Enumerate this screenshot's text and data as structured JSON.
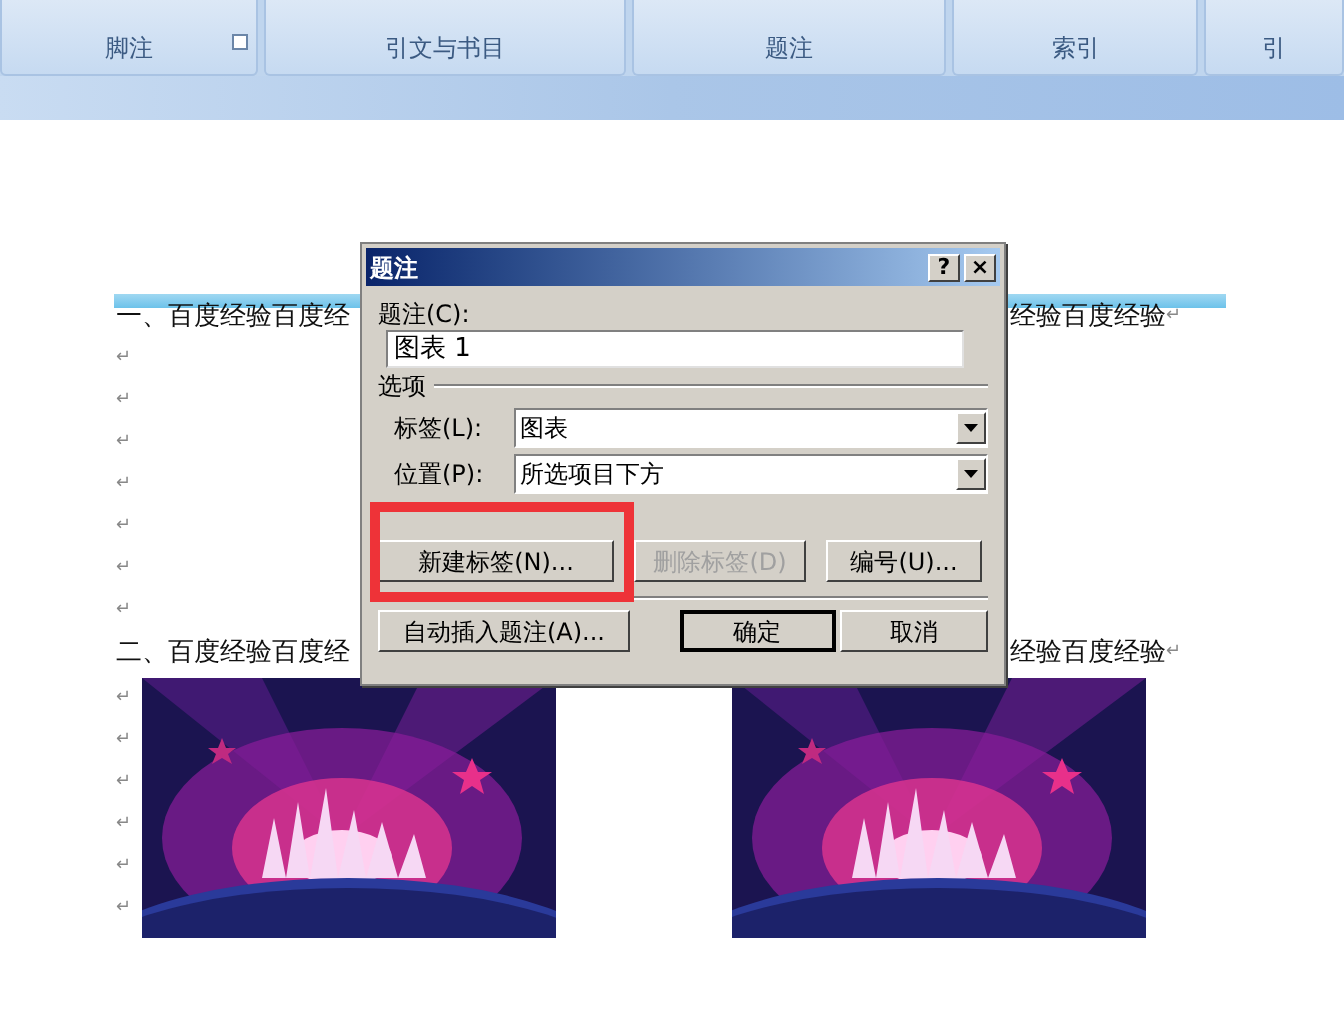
{
  "ribbon": {
    "groups": [
      {
        "label": "脚注",
        "launcher": true
      },
      {
        "label": "引文与书目",
        "launcher": false
      },
      {
        "label": "题注",
        "launcher": false
      },
      {
        "label": "索引",
        "launcher": false
      },
      {
        "label": "引",
        "launcher": false
      }
    ]
  },
  "document": {
    "lines": [
      {
        "kind": "text",
        "left": "一、百度经验百度经",
        "right": "经验百度经验",
        "mark": "↵"
      },
      {
        "kind": "mark",
        "mark": "↵"
      },
      {
        "kind": "mark",
        "mark": "↵"
      },
      {
        "kind": "mark",
        "mark": "↵"
      },
      {
        "kind": "mark",
        "mark": "↵"
      },
      {
        "kind": "mark",
        "mark": "↵"
      },
      {
        "kind": "mark",
        "mark": "↵"
      },
      {
        "kind": "mark",
        "mark": "↵"
      },
      {
        "kind": "text",
        "left": "二、百度经验百度经",
        "right": "经验百度经验",
        "mark": "↵"
      }
    ],
    "image_marks": [
      "↵",
      "↵",
      "↵",
      "↵",
      "↵",
      "↵"
    ]
  },
  "dialog": {
    "title": "题注",
    "help": "?",
    "close": "×",
    "caption_label": "题注(C):",
    "caption_value": "图表 1",
    "options_heading": "选项",
    "fields": [
      {
        "label": "标签(L):",
        "value": "图表"
      },
      {
        "label": "位置(P):",
        "value": "所选项目下方"
      }
    ],
    "row_buttons": [
      {
        "label": "新建标签(N)...",
        "disabled": false,
        "highlighted": true
      },
      {
        "label": "删除标签(D)",
        "disabled": true,
        "highlighted": false
      },
      {
        "label": "编号(U)...",
        "disabled": false,
        "highlighted": false
      }
    ],
    "bottom_buttons": [
      {
        "label": "自动插入题注(A)...",
        "default": false
      },
      {
        "label": "确定",
        "default": true
      },
      {
        "label": "取消",
        "default": false
      }
    ]
  }
}
